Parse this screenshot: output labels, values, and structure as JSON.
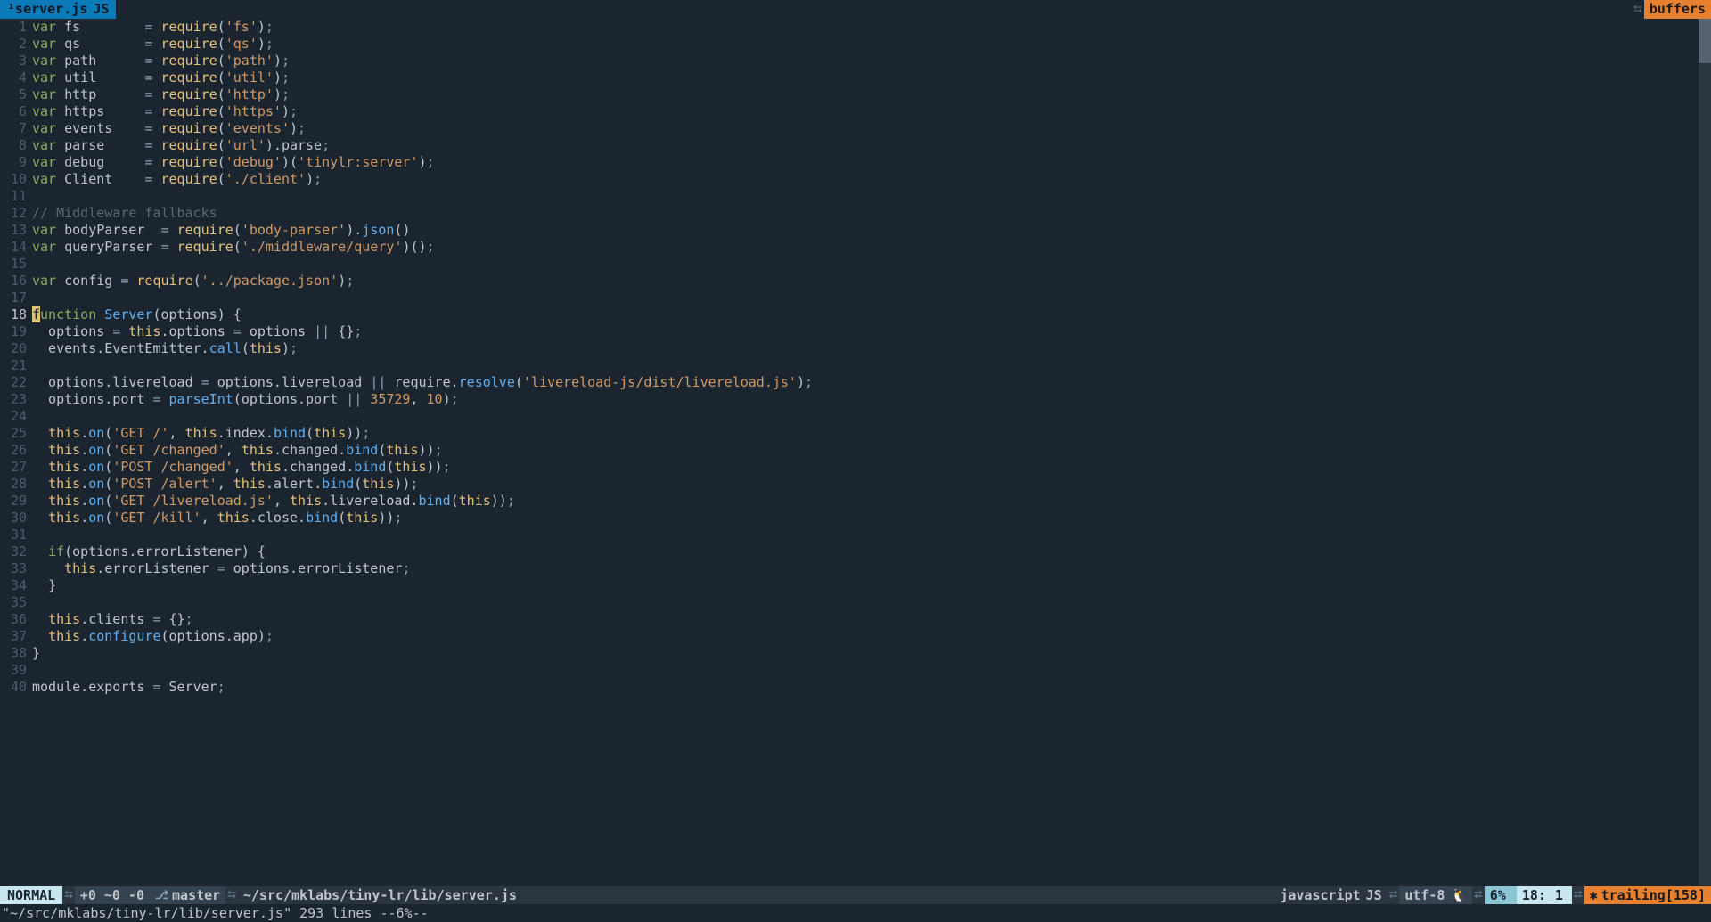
{
  "tab": {
    "filename": "¹server.js",
    "filetype": "JS"
  },
  "topright": {
    "buffers": "buffers"
  },
  "gutter_start": 1,
  "gutter_end": 40,
  "current_line": 18,
  "statusline": {
    "mode": "NORMAL",
    "changes": "+0 ~0 -0",
    "branch": "master",
    "path": "~/src/mklabs/tiny-lr/lib/server.js",
    "filetype": "javascript",
    "filetype_badge": "JS",
    "encoding": "utf-8",
    "percent": "6%",
    "line": "18",
    "col": "1",
    "trailing": "trailing[158]"
  },
  "cmdline": "\"~/src/mklabs/tiny-lr/lib/server.js\" 293 lines --6%--",
  "code": [
    [
      [
        "kw",
        "var"
      ],
      [
        "ident",
        " fs        "
      ],
      [
        "op",
        "= "
      ],
      [
        "builtin",
        "require"
      ],
      [
        "paren",
        "("
      ],
      [
        "str",
        "'fs'"
      ],
      [
        "paren",
        ")"
      ],
      [
        "op",
        ";"
      ]
    ],
    [
      [
        "kw",
        "var"
      ],
      [
        "ident",
        " qs        "
      ],
      [
        "op",
        "= "
      ],
      [
        "builtin",
        "require"
      ],
      [
        "paren",
        "("
      ],
      [
        "str",
        "'qs'"
      ],
      [
        "paren",
        ")"
      ],
      [
        "op",
        ";"
      ]
    ],
    [
      [
        "kw",
        "var"
      ],
      [
        "ident",
        " path      "
      ],
      [
        "op",
        "= "
      ],
      [
        "builtin",
        "require"
      ],
      [
        "paren",
        "("
      ],
      [
        "str",
        "'path'"
      ],
      [
        "paren",
        ")"
      ],
      [
        "op",
        ";"
      ]
    ],
    [
      [
        "kw",
        "var"
      ],
      [
        "ident",
        " util      "
      ],
      [
        "op",
        "= "
      ],
      [
        "builtin",
        "require"
      ],
      [
        "paren",
        "("
      ],
      [
        "str",
        "'util'"
      ],
      [
        "paren",
        ")"
      ],
      [
        "op",
        ";"
      ]
    ],
    [
      [
        "kw",
        "var"
      ],
      [
        "ident",
        " http      "
      ],
      [
        "op",
        "= "
      ],
      [
        "builtin",
        "require"
      ],
      [
        "paren",
        "("
      ],
      [
        "str",
        "'http'"
      ],
      [
        "paren",
        ")"
      ],
      [
        "op",
        ";"
      ]
    ],
    [
      [
        "kw",
        "var"
      ],
      [
        "ident",
        " https     "
      ],
      [
        "op",
        "= "
      ],
      [
        "builtin",
        "require"
      ],
      [
        "paren",
        "("
      ],
      [
        "str",
        "'https'"
      ],
      [
        "paren",
        ")"
      ],
      [
        "op",
        ";"
      ]
    ],
    [
      [
        "kw",
        "var"
      ],
      [
        "ident",
        " events    "
      ],
      [
        "op",
        "= "
      ],
      [
        "builtin",
        "require"
      ],
      [
        "paren",
        "("
      ],
      [
        "str",
        "'events'"
      ],
      [
        "paren",
        ")"
      ],
      [
        "op",
        ";"
      ]
    ],
    [
      [
        "kw",
        "var"
      ],
      [
        "ident",
        " parse     "
      ],
      [
        "op",
        "= "
      ],
      [
        "builtin",
        "require"
      ],
      [
        "paren",
        "("
      ],
      [
        "str",
        "'url'"
      ],
      [
        "paren",
        ")"
      ],
      [
        "ident",
        ".parse"
      ],
      [
        "op",
        ";"
      ]
    ],
    [
      [
        "kw",
        "var"
      ],
      [
        "ident",
        " debug     "
      ],
      [
        "op",
        "= "
      ],
      [
        "builtin",
        "require"
      ],
      [
        "paren",
        "("
      ],
      [
        "str",
        "'debug'"
      ],
      [
        "paren",
        ")("
      ],
      [
        "str",
        "'tinylr:server'"
      ],
      [
        "paren",
        ")"
      ],
      [
        "op",
        ";"
      ]
    ],
    [
      [
        "kw",
        "var"
      ],
      [
        "ident",
        " Client    "
      ],
      [
        "op",
        "= "
      ],
      [
        "builtin",
        "require"
      ],
      [
        "paren",
        "("
      ],
      [
        "str",
        "'./client'"
      ],
      [
        "paren",
        ")"
      ],
      [
        "op",
        ";"
      ]
    ],
    [],
    [
      [
        "cmt",
        "// Middleware fallbacks"
      ]
    ],
    [
      [
        "kw",
        "var"
      ],
      [
        "ident",
        " bodyParser  "
      ],
      [
        "op",
        "= "
      ],
      [
        "builtin",
        "require"
      ],
      [
        "paren",
        "("
      ],
      [
        "str",
        "'body-parser'"
      ],
      [
        "paren",
        ")"
      ],
      [
        "ident",
        "."
      ],
      [
        "call",
        "json"
      ],
      [
        "paren",
        "()"
      ]
    ],
    [
      [
        "kw",
        "var"
      ],
      [
        "ident",
        " queryParser "
      ],
      [
        "op",
        "= "
      ],
      [
        "builtin",
        "require"
      ],
      [
        "paren",
        "("
      ],
      [
        "str",
        "'./middleware/query'"
      ],
      [
        "paren",
        ")()"
      ],
      [
        "op",
        ";"
      ]
    ],
    [],
    [
      [
        "kw",
        "var"
      ],
      [
        "ident",
        " config "
      ],
      [
        "op",
        "= "
      ],
      [
        "builtin",
        "require"
      ],
      [
        "paren",
        "("
      ],
      [
        "str",
        "'../package.json'"
      ],
      [
        "paren",
        ")"
      ],
      [
        "op",
        ";"
      ]
    ],
    [],
    [
      [
        "cursor",
        "f"
      ],
      [
        "kw",
        "unction"
      ],
      [
        "ident",
        " "
      ],
      [
        "fn-name",
        "Server"
      ],
      [
        "paren",
        "("
      ],
      [
        "ident",
        "options"
      ],
      [
        "paren",
        ") {"
      ]
    ],
    [
      [
        "ident",
        "  options "
      ],
      [
        "op",
        "= "
      ],
      [
        "thiskw",
        "this"
      ],
      [
        "ident",
        ".options "
      ],
      [
        "op",
        "= "
      ],
      [
        "ident",
        "options "
      ],
      [
        "op",
        "|| "
      ],
      [
        "paren",
        "{}"
      ],
      [
        "op",
        ";"
      ]
    ],
    [
      [
        "ident",
        "  events.EventEmitter."
      ],
      [
        "call",
        "call"
      ],
      [
        "paren",
        "("
      ],
      [
        "thiskw",
        "this"
      ],
      [
        "paren",
        ")"
      ],
      [
        "op",
        ";"
      ]
    ],
    [],
    [
      [
        "ident",
        "  options.livereload "
      ],
      [
        "op",
        "= "
      ],
      [
        "ident",
        "options.livereload "
      ],
      [
        "op",
        "|| "
      ],
      [
        "ident",
        "require."
      ],
      [
        "call",
        "resolve"
      ],
      [
        "paren",
        "("
      ],
      [
        "str",
        "'livereload-js/dist/livereload.js'"
      ],
      [
        "paren",
        ")"
      ],
      [
        "op",
        ";"
      ]
    ],
    [
      [
        "ident",
        "  options.port "
      ],
      [
        "op",
        "= "
      ],
      [
        "call",
        "parseInt"
      ],
      [
        "paren",
        "("
      ],
      [
        "ident",
        "options.port "
      ],
      [
        "op",
        "|| "
      ],
      [
        "num",
        "35729"
      ],
      [
        "ident",
        ", "
      ],
      [
        "num",
        "10"
      ],
      [
        "paren",
        ")"
      ],
      [
        "op",
        ";"
      ]
    ],
    [],
    [
      [
        "ident",
        "  "
      ],
      [
        "thiskw",
        "this"
      ],
      [
        "ident",
        "."
      ],
      [
        "call",
        "on"
      ],
      [
        "paren",
        "("
      ],
      [
        "str",
        "'GET /'"
      ],
      [
        "ident",
        ", "
      ],
      [
        "thiskw",
        "this"
      ],
      [
        "ident",
        ".index."
      ],
      [
        "call",
        "bind"
      ],
      [
        "paren",
        "("
      ],
      [
        "thiskw",
        "this"
      ],
      [
        "paren",
        "))"
      ],
      [
        "op",
        ";"
      ]
    ],
    [
      [
        "ident",
        "  "
      ],
      [
        "thiskw",
        "this"
      ],
      [
        "ident",
        "."
      ],
      [
        "call",
        "on"
      ],
      [
        "paren",
        "("
      ],
      [
        "str",
        "'GET /changed'"
      ],
      [
        "ident",
        ", "
      ],
      [
        "thiskw",
        "this"
      ],
      [
        "ident",
        ".changed."
      ],
      [
        "call",
        "bind"
      ],
      [
        "paren",
        "("
      ],
      [
        "thiskw",
        "this"
      ],
      [
        "paren",
        "))"
      ],
      [
        "op",
        ";"
      ]
    ],
    [
      [
        "ident",
        "  "
      ],
      [
        "thiskw",
        "this"
      ],
      [
        "ident",
        "."
      ],
      [
        "call",
        "on"
      ],
      [
        "paren",
        "("
      ],
      [
        "str",
        "'POST /changed'"
      ],
      [
        "ident",
        ", "
      ],
      [
        "thiskw",
        "this"
      ],
      [
        "ident",
        ".changed."
      ],
      [
        "call",
        "bind"
      ],
      [
        "paren",
        "("
      ],
      [
        "thiskw",
        "this"
      ],
      [
        "paren",
        "))"
      ],
      [
        "op",
        ";"
      ]
    ],
    [
      [
        "ident",
        "  "
      ],
      [
        "thiskw",
        "this"
      ],
      [
        "ident",
        "."
      ],
      [
        "call",
        "on"
      ],
      [
        "paren",
        "("
      ],
      [
        "str",
        "'POST /alert'"
      ],
      [
        "ident",
        ", "
      ],
      [
        "thiskw",
        "this"
      ],
      [
        "ident",
        ".alert."
      ],
      [
        "call",
        "bind"
      ],
      [
        "paren",
        "("
      ],
      [
        "thiskw",
        "this"
      ],
      [
        "paren",
        "))"
      ],
      [
        "op",
        ";"
      ]
    ],
    [
      [
        "ident",
        "  "
      ],
      [
        "thiskw",
        "this"
      ],
      [
        "ident",
        "."
      ],
      [
        "call",
        "on"
      ],
      [
        "paren",
        "("
      ],
      [
        "str",
        "'GET /livereload.js'"
      ],
      [
        "ident",
        ", "
      ],
      [
        "thiskw",
        "this"
      ],
      [
        "ident",
        ".livereload."
      ],
      [
        "call",
        "bind"
      ],
      [
        "paren",
        "("
      ],
      [
        "thiskw",
        "this"
      ],
      [
        "paren",
        "))"
      ],
      [
        "op",
        ";"
      ]
    ],
    [
      [
        "ident",
        "  "
      ],
      [
        "thiskw",
        "this"
      ],
      [
        "ident",
        "."
      ],
      [
        "call",
        "on"
      ],
      [
        "paren",
        "("
      ],
      [
        "str",
        "'GET /kill'"
      ],
      [
        "ident",
        ", "
      ],
      [
        "thiskw",
        "this"
      ],
      [
        "ident",
        ".close."
      ],
      [
        "call",
        "bind"
      ],
      [
        "paren",
        "("
      ],
      [
        "thiskw",
        "this"
      ],
      [
        "paren",
        "))"
      ],
      [
        "op",
        ";"
      ]
    ],
    [],
    [
      [
        "ident",
        "  "
      ],
      [
        "kw",
        "if"
      ],
      [
        "paren",
        "("
      ],
      [
        "ident",
        "options.errorListener"
      ],
      [
        "paren",
        ") {"
      ]
    ],
    [
      [
        "ident",
        "    "
      ],
      [
        "thiskw",
        "this"
      ],
      [
        "ident",
        ".errorListener "
      ],
      [
        "op",
        "= "
      ],
      [
        "ident",
        "options.errorListener"
      ],
      [
        "op",
        ";"
      ]
    ],
    [
      [
        "ident",
        "  "
      ],
      [
        "paren",
        "}"
      ]
    ],
    [],
    [
      [
        "ident",
        "  "
      ],
      [
        "thiskw",
        "this"
      ],
      [
        "ident",
        ".clients "
      ],
      [
        "op",
        "= "
      ],
      [
        "paren",
        "{}"
      ],
      [
        "op",
        ";"
      ]
    ],
    [
      [
        "ident",
        "  "
      ],
      [
        "thiskw",
        "this"
      ],
      [
        "ident",
        "."
      ],
      [
        "call",
        "configure"
      ],
      [
        "paren",
        "("
      ],
      [
        "ident",
        "options.app"
      ],
      [
        "paren",
        ")"
      ],
      [
        "op",
        ";"
      ]
    ],
    [
      [
        "paren",
        "}"
      ]
    ],
    [],
    [
      [
        "ident",
        "module.exports "
      ],
      [
        "op",
        "= "
      ],
      [
        "ident",
        "Server"
      ],
      [
        "op",
        ";"
      ]
    ]
  ]
}
